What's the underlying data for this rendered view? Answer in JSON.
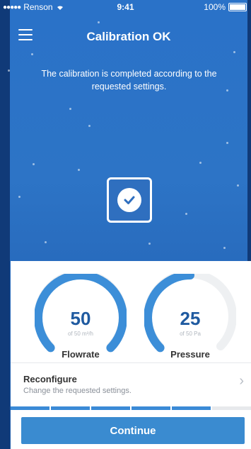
{
  "status_bar": {
    "carrier": "Renson",
    "time": "9:41",
    "battery": "100%"
  },
  "header": {
    "title": "Calibration OK",
    "menu_icon": "hamburger-menu-icon"
  },
  "message": "The calibration is completed according to the requested settings.",
  "status_icon": "check-circle-icon",
  "gauges": [
    {
      "value": "50",
      "subtext": "of 50 m³/h",
      "label": "Flowrate",
      "fraction": 1.0
    },
    {
      "value": "25",
      "subtext": "of 50 Pa",
      "label": "Pressure",
      "fraction": 0.5
    }
  ],
  "reconfigure": {
    "title": "Reconfigure",
    "subtitle": "Change the requested settings.",
    "icon": "chevron-right-icon"
  },
  "progress": {
    "steps_total": 5,
    "steps_complete": 5
  },
  "continue_label": "Continue",
  "colors": {
    "background": "#2a72c8",
    "accent": "#3a8bd0",
    "gauge_active": "#3c8ed8",
    "gauge_track": "#eef0f2"
  }
}
